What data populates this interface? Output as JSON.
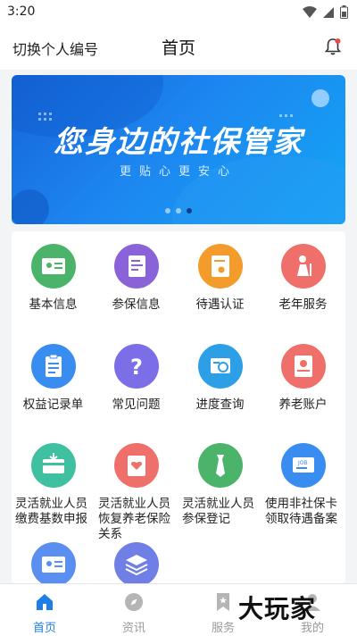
{
  "status_bar": {
    "time": "3:20"
  },
  "header": {
    "left_link": "切换个人编号",
    "title": "首页"
  },
  "banner": {
    "title": "您身边的社保管家",
    "subtitle": "更贴心更安心"
  },
  "services": [
    {
      "label": "基本信息",
      "color": "#4cb46a",
      "icon": "id-card-icon"
    },
    {
      "label": "参保信息",
      "color": "#8b63d8",
      "icon": "document-icon"
    },
    {
      "label": "待遇认证",
      "color": "#f39b2b",
      "icon": "certificate-icon"
    },
    {
      "label": "老年服务",
      "color": "#ef6f6a",
      "icon": "elder-icon"
    },
    {
      "label": "权益记录单",
      "color": "#3a8df0",
      "icon": "clipboard-icon"
    },
    {
      "label": "常见问题",
      "color": "#7b6ee6",
      "icon": "question-icon"
    },
    {
      "label": "进度查询",
      "color": "#2c9fe6",
      "icon": "search-doc-icon"
    },
    {
      "label": "养老账户",
      "color": "#ef6f6a",
      "icon": "account-icon"
    },
    {
      "label": "灵活就业人员缴费基数申报",
      "color": "#3fc0a0",
      "icon": "wallet-icon"
    },
    {
      "label": "灵活就业人员恢复养老保险关系",
      "color": "#ef6f6a",
      "icon": "heart-card-icon"
    },
    {
      "label": "灵活就业人员参保登记",
      "color": "#4cb46a",
      "icon": "tie-icon"
    },
    {
      "label": "使用非社保卡领取待遇备案",
      "color": "#3a8df0",
      "icon": "card-register-icon"
    },
    {
      "label": "",
      "color": "#5a8ef0",
      "icon": "id-card-icon"
    },
    {
      "label": "",
      "color": "#6f7fe6",
      "icon": "layers-icon"
    }
  ],
  "bottom_nav": [
    {
      "label": "首页",
      "icon": "home-icon"
    },
    {
      "label": "资讯",
      "icon": "compass-icon"
    },
    {
      "label": "服务",
      "icon": "bookmark-icon"
    },
    {
      "label": "我的",
      "icon": "user-icon"
    }
  ],
  "watermark": "大玩家",
  "colors": {
    "accent": "#1e7ee6",
    "banner": "#1d86f0"
  }
}
